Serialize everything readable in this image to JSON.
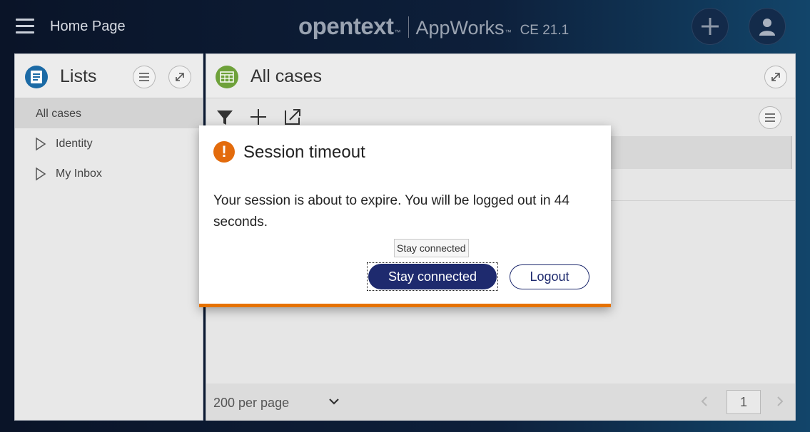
{
  "header": {
    "title": "Home Page",
    "brand_opentext": "opentext",
    "brand_tm": "™",
    "brand_appworks": "AppWorks",
    "brand_version": "CE 21.1"
  },
  "lists_panel": {
    "title": "Lists",
    "items": [
      {
        "label": "All cases"
      },
      {
        "label": "Identity"
      },
      {
        "label": "My Inbox"
      }
    ]
  },
  "cases_panel": {
    "title": "All cases",
    "footer": {
      "per_page": "200 per page",
      "page_number": "1"
    }
  },
  "dialog": {
    "title": "Session timeout",
    "icon_glyph": "!",
    "message": "Your session is about to expire. You will be logged out in 44 seconds.",
    "tooltip": "Stay connected",
    "stay_label": "Stay connected",
    "logout_label": "Logout"
  },
  "colors": {
    "accent_orange": "#e57200",
    "primary_navy": "#1e2a6e",
    "lists_icon": "#1b6aa5",
    "cases_icon": "#6ea13a"
  }
}
